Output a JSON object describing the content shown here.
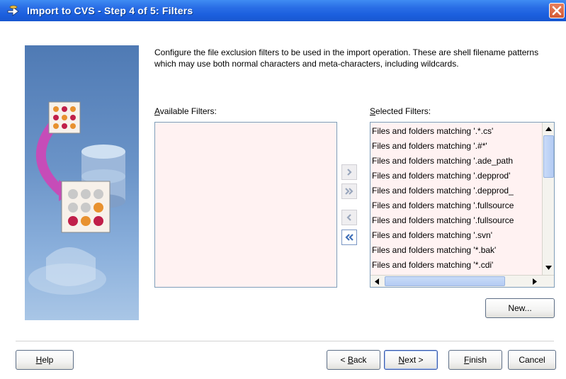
{
  "window": {
    "title": "Import to CVS - Step 4 of 5: Filters"
  },
  "description": "Configure the file exclusion filters to be used in the import operation. These are shell filename patterns which may use both normal characters and meta-characters, including wildcards.",
  "available": {
    "label_mnemonic": "A",
    "label_rest": "vailable Filters:"
  },
  "selected": {
    "label_mnemonic": "S",
    "label_rest": "elected Filters:",
    "items": [
      "Files and folders matching '.*.cs'",
      "Files and folders matching '.#*'",
      "Files and folders matching '.ade_path",
      "Files and folders matching '.depprod'",
      "Files and folders matching '.depprod_",
      "Files and folders matching '.fullsource",
      "Files and folders matching '.fullsource",
      "Files and folders matching '.svn'",
      "Files and folders matching '*.bak'",
      "Files and folders matching '*.cdi'"
    ]
  },
  "buttons": {
    "new": "New...",
    "help_mnemonic": "H",
    "help_rest": "elp",
    "back_prefix": "< ",
    "back_mnemonic": "B",
    "back_rest": "ack",
    "next_mnemonic": "N",
    "next_rest": "ext >",
    "finish_mnemonic": "F",
    "finish_rest": "inish",
    "cancel": "Cancel"
  },
  "colors": {
    "titlebar": "#2a6ee6",
    "list_background": "#fff2f2",
    "shuttle_arrow": "#3f6fb8"
  },
  "icons": {
    "title": "cvs-import-icon",
    "close": "close-icon",
    "add": "move-right-icon",
    "add_all": "move-all-right-icon",
    "remove": "move-left-icon",
    "remove_all": "move-all-left-icon"
  }
}
